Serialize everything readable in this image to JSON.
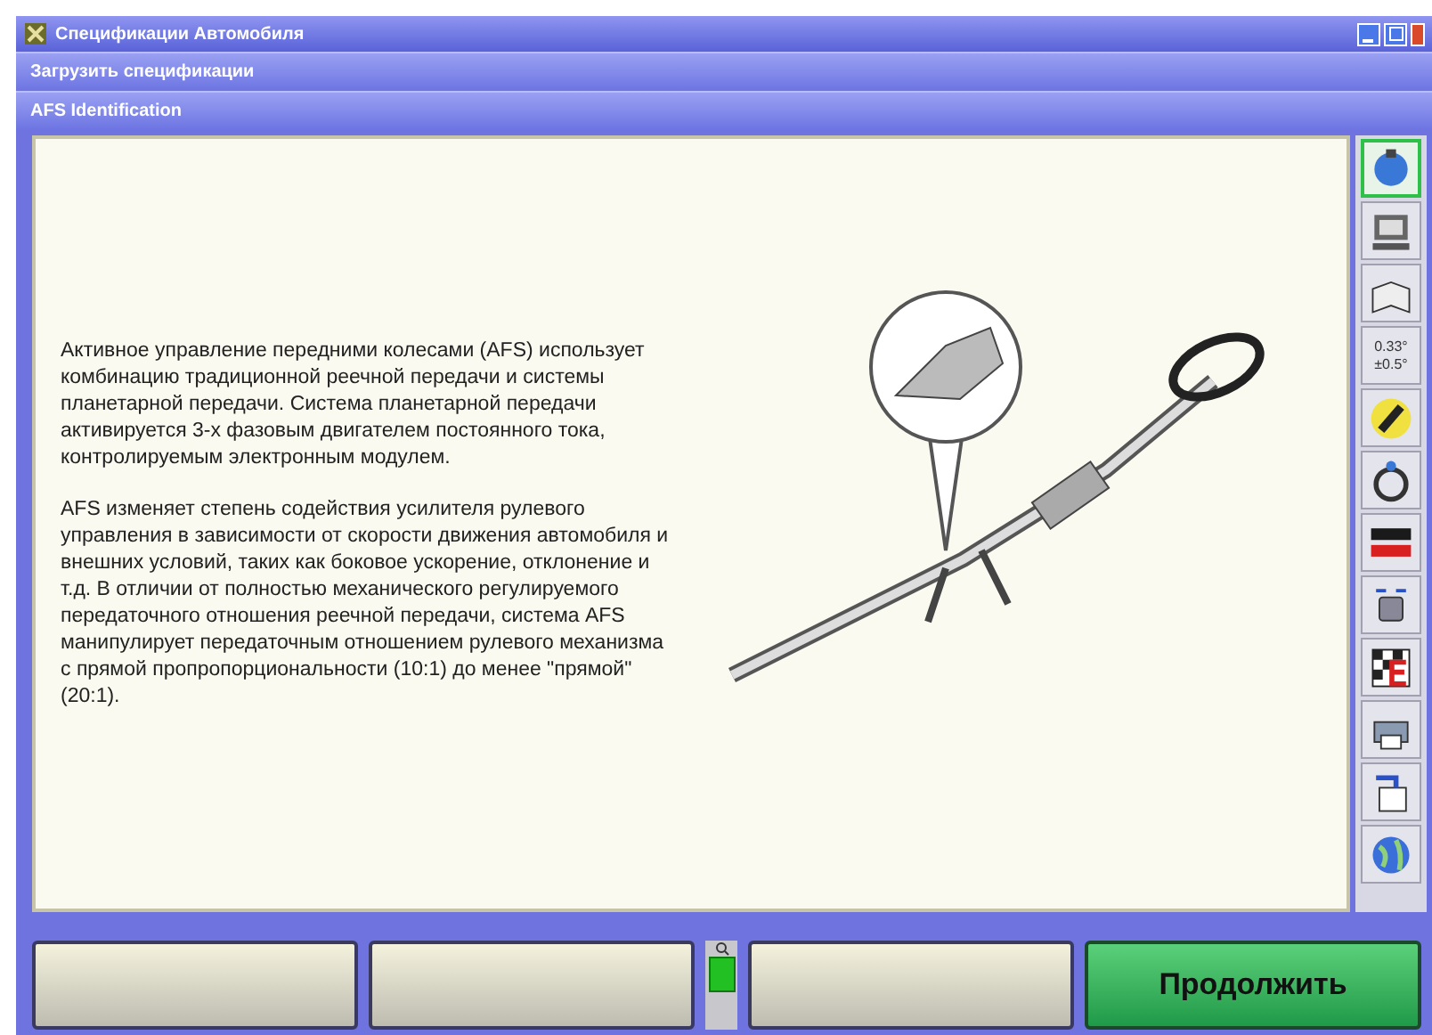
{
  "window": {
    "title": "Спецификации Автомобиля"
  },
  "menu_bar": {
    "label": "Загрузить спецификации"
  },
  "section_bar": {
    "label": "AFS Identification"
  },
  "content": {
    "paragraphs": [
      "Активное управление передними колесами (AFS) использует комбинацию традиционной реечной передачи и системы планетарной передачи. Система планетарной передачи активируется 3-х фазовым двигателем постоянного тока, контролируемым электронным модулем.",
      "AFS изменяет степень содействия усилителя рулевого управления в зависимости от скорости движения автомобиля и внешних условий, таких как боковое ускорение, отклонение и т.д. В отличии от полностью механического регулируемого передаточного отношения реечной передачи, система AFS манипулирует передаточным отношением рулевого механизма с прямой пропропорциональности (10:1) до менее \"прямой\" (20:1)."
    ]
  },
  "toolbar": [
    {
      "kind": "icon",
      "selected": true
    },
    {
      "kind": "icon",
      "selected": false
    },
    {
      "kind": "icon",
      "selected": false
    },
    {
      "kind": "reading",
      "lines": [
        "0.33°",
        "±0.5°"
      ],
      "selected": false
    },
    {
      "kind": "icon",
      "selected": false
    },
    {
      "kind": "icon",
      "selected": false
    },
    {
      "kind": "icon",
      "selected": false
    },
    {
      "kind": "icon",
      "selected": false
    },
    {
      "kind": "icon",
      "selected": false
    },
    {
      "kind": "icon",
      "selected": false
    },
    {
      "kind": "icon",
      "selected": false
    },
    {
      "kind": "icon",
      "selected": false
    }
  ],
  "buttons": [
    {
      "kind": "blank"
    },
    {
      "kind": "blank"
    },
    {
      "kind": "indicator"
    },
    {
      "kind": "blank"
    },
    {
      "kind": "primary",
      "label": "Продолжить"
    }
  ]
}
